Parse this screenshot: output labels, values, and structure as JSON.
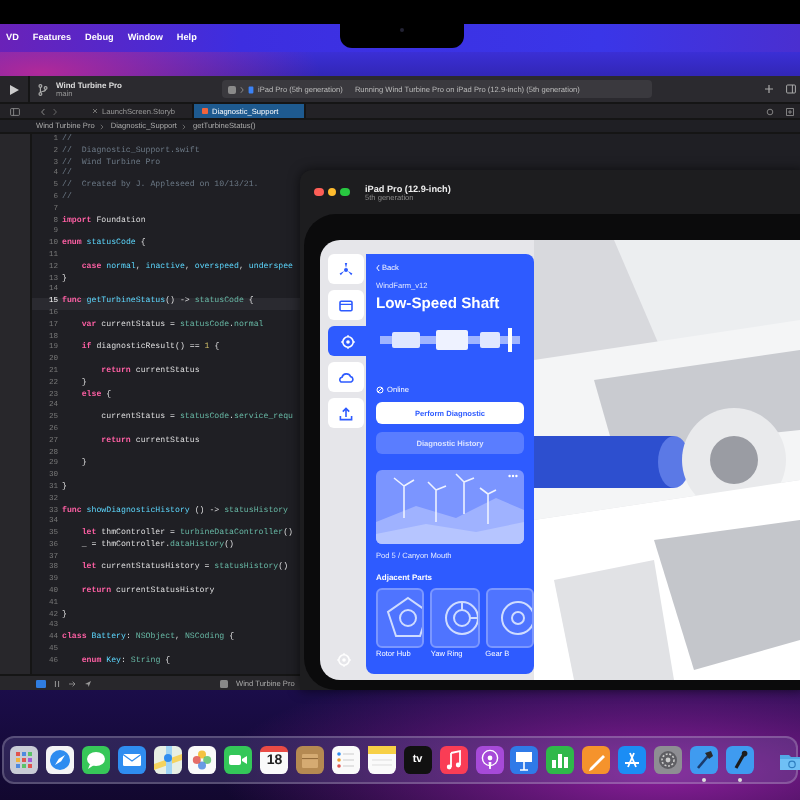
{
  "menu_bar": {
    "items": [
      "VD",
      "Features",
      "Debug",
      "Window",
      "Help"
    ]
  },
  "xcode": {
    "toolbar": {
      "project": "Wind Turbine Pro",
      "branch": "main",
      "destination": "iPad Pro (5th generation)",
      "status": "Running Wind Turbine Pro on iPad Pro (12.9-inch) (5th generation)"
    },
    "tabs": [
      {
        "label": "LaunchScreen.Storyb",
        "selected": false
      },
      {
        "label": "Diagnostic_Support",
        "selected": true
      }
    ],
    "breadcrumb": [
      "Wind Turbine Pro",
      "Diagnostic_Support",
      "getTurbineStatus()"
    ],
    "lines": [
      {
        "no": "1",
        "current": false,
        "parts": [
          {
            "kind": "comment",
            "text": "//"
          }
        ]
      },
      {
        "no": "2",
        "current": false,
        "parts": [
          {
            "kind": "comment",
            "text": "//  Diagnostic_Support.swift"
          }
        ]
      },
      {
        "no": "3",
        "current": false,
        "parts": [
          {
            "kind": "comment",
            "text": "//  Wind Turbine Pro"
          }
        ]
      },
      {
        "no": "4",
        "current": false,
        "parts": [
          {
            "kind": "comment",
            "text": "//"
          }
        ]
      },
      {
        "no": "5",
        "current": false,
        "parts": [
          {
            "kind": "comment",
            "text": "//  Created by J. Appleseed on 10/13/21."
          }
        ]
      },
      {
        "no": "6",
        "current": false,
        "parts": [
          {
            "kind": "comment",
            "text": "//"
          }
        ]
      },
      {
        "no": "7",
        "current": false
      },
      {
        "no": "8",
        "current": false,
        "parts": [
          {
            "kind": "keyword",
            "text": "import"
          },
          {
            "kind": "plain",
            "text": " Foundation"
          }
        ]
      },
      {
        "no": "9",
        "current": false
      },
      {
        "no": "10",
        "current": false,
        "parts": [
          {
            "kind": "keyword",
            "text": "enum"
          },
          {
            "kind": "name",
            "text": " statusCode"
          },
          {
            "kind": "plain",
            "text": " {"
          }
        ]
      },
      {
        "no": "11",
        "current": false
      },
      {
        "no": "12",
        "current": false,
        "parts": [
          {
            "kind": "keyword",
            "text": "    case"
          },
          {
            "kind": "name",
            "text": " normal"
          },
          {
            "kind": "plain",
            "text": ", "
          },
          {
            "kind": "name",
            "text": "inactive"
          },
          {
            "kind": "plain",
            "text": ", "
          },
          {
            "kind": "name",
            "text": "overspeed"
          },
          {
            "kind": "plain",
            "text": ", "
          },
          {
            "kind": "name",
            "text": "underspee"
          }
        ]
      },
      {
        "no": "13",
        "current": false,
        "parts": [
          {
            "kind": "plain",
            "text": "}"
          }
        ]
      },
      {
        "no": "14",
        "current": false
      },
      {
        "no": "15",
        "current": true,
        "parts": [
          {
            "kind": "keyword",
            "text": "func"
          },
          {
            "kind": "name",
            "text": " getTurbineStatus"
          },
          {
            "kind": "plain",
            "text": "() -> "
          },
          {
            "kind": "type",
            "text": "statusCode"
          },
          {
            "kind": "plain",
            "text": " {"
          }
        ]
      },
      {
        "no": "16",
        "current": false
      },
      {
        "no": "17",
        "current": false,
        "parts": [
          {
            "kind": "keyword",
            "text": "    var"
          },
          {
            "kind": "plain",
            "text": " currentStatus = "
          },
          {
            "kind": "type",
            "text": "statusCode"
          },
          {
            "kind": "plain",
            "text": "."
          },
          {
            "kind": "type",
            "text": "normal"
          }
        ]
      },
      {
        "no": "18",
        "current": false
      },
      {
        "no": "19",
        "current": false,
        "parts": [
          {
            "kind": "keyword",
            "text": "    if"
          },
          {
            "kind": "plain",
            "text": " diagnosticResult() == "
          },
          {
            "kind": "number",
            "text": "1"
          },
          {
            "kind": "plain",
            "text": " {"
          }
        ]
      },
      {
        "no": "20",
        "current": false
      },
      {
        "no": "21",
        "current": false,
        "parts": [
          {
            "kind": "keyword",
            "text": "        return"
          },
          {
            "kind": "plain",
            "text": " currentStatus"
          }
        ]
      },
      {
        "no": "22",
        "current": false,
        "parts": [
          {
            "kind": "plain",
            "text": "    }"
          }
        ]
      },
      {
        "no": "23",
        "current": false,
        "parts": [
          {
            "kind": "keyword",
            "text": "    else"
          },
          {
            "kind": "plain",
            "text": " {"
          }
        ]
      },
      {
        "no": "24",
        "current": false
      },
      {
        "no": "25",
        "current": false,
        "parts": [
          {
            "kind": "plain",
            "text": "        currentStatus = "
          },
          {
            "kind": "type",
            "text": "statusCode"
          },
          {
            "kind": "plain",
            "text": "."
          },
          {
            "kind": "type",
            "text": "service_requ"
          }
        ]
      },
      {
        "no": "26",
        "current": false
      },
      {
        "no": "27",
        "current": false,
        "parts": [
          {
            "kind": "keyword",
            "text": "        return"
          },
          {
            "kind": "plain",
            "text": " currentStatus"
          }
        ]
      },
      {
        "no": "28",
        "current": false
      },
      {
        "no": "29",
        "current": false,
        "parts": [
          {
            "kind": "plain",
            "text": "    }"
          }
        ]
      },
      {
        "no": "30",
        "current": false
      },
      {
        "no": "31",
        "current": false,
        "parts": [
          {
            "kind": "plain",
            "text": "}"
          }
        ]
      },
      {
        "no": "32",
        "current": false
      },
      {
        "no": "33",
        "current": false,
        "parts": [
          {
            "kind": "keyword",
            "text": "func"
          },
          {
            "kind": "name",
            "text": " showDiagnosticHistory"
          },
          {
            "kind": "plain",
            "text": " () -> "
          },
          {
            "kind": "type",
            "text": "statusHistory"
          }
        ]
      },
      {
        "no": "34",
        "current": false
      },
      {
        "no": "35",
        "current": false,
        "parts": [
          {
            "kind": "keyword",
            "text": "    let"
          },
          {
            "kind": "plain",
            "text": " thmController = "
          },
          {
            "kind": "type",
            "text": "turbineDataController"
          },
          {
            "kind": "plain",
            "text": "()"
          }
        ]
      },
      {
        "no": "36",
        "current": false,
        "parts": [
          {
            "kind": "plain",
            "text": "    _ = thmController."
          },
          {
            "kind": "type",
            "text": "dataHistory"
          },
          {
            "kind": "plain",
            "text": "()"
          }
        ]
      },
      {
        "no": "37",
        "current": false
      },
      {
        "no": "38",
        "current": false,
        "parts": [
          {
            "kind": "keyword",
            "text": "    let"
          },
          {
            "kind": "plain",
            "text": " currentStatusHistory = "
          },
          {
            "kind": "type",
            "text": "statusHistory"
          },
          {
            "kind": "plain",
            "text": "()"
          }
        ]
      },
      {
        "no": "39",
        "current": false
      },
      {
        "no": "40",
        "current": false,
        "parts": [
          {
            "kind": "keyword",
            "text": "    return"
          },
          {
            "kind": "plain",
            "text": " currentStatusHistory"
          }
        ]
      },
      {
        "no": "41",
        "current": false
      },
      {
        "no": "42",
        "current": false,
        "parts": [
          {
            "kind": "plain",
            "text": "}"
          }
        ]
      },
      {
        "no": "43",
        "current": false
      },
      {
        "no": "44",
        "current": false,
        "parts": [
          {
            "kind": "keyword",
            "text": "class"
          },
          {
            "kind": "name",
            "text": " Battery"
          },
          {
            "kind": "plain",
            "text": ": "
          },
          {
            "kind": "type",
            "text": "NSObject"
          },
          {
            "kind": "plain",
            "text": ", "
          },
          {
            "kind": "type",
            "text": "NSCoding"
          },
          {
            "kind": "plain",
            "text": " {"
          }
        ]
      },
      {
        "no": "45",
        "current": false
      },
      {
        "no": "46",
        "current": false,
        "parts": [
          {
            "kind": "keyword",
            "text": "    enum"
          },
          {
            "kind": "name",
            "text": " Key"
          },
          {
            "kind": "plain",
            "text": ": "
          },
          {
            "kind": "type",
            "text": "String"
          },
          {
            "kind": "plain",
            "text": " {"
          }
        ]
      }
    ],
    "debug_bar": {
      "target": "Wind Turbine Pro"
    }
  },
  "simulator": {
    "title": "iPad Pro (12.9-inch)",
    "subtitle": "5th generation",
    "sidebar": [
      {
        "kind": "fan",
        "selected": false
      },
      {
        "kind": "card",
        "selected": false
      },
      {
        "kind": "gear",
        "selected": true
      },
      {
        "kind": "cloud",
        "selected": false
      },
      {
        "kind": "upload",
        "selected": false
      }
    ],
    "panel": {
      "back": "Back",
      "subtitle": "WindFarm_v12",
      "title": "Low-Speed Shaft",
      "status": "Online",
      "primary_button": "Perform Diagnostic",
      "secondary_button": "Diagnostic History",
      "image_caption": "Pod 5 / Canyon Mouth",
      "section": "Adjacent Parts",
      "parts": [
        {
          "kind": "rotor",
          "label": "Rotor Hub"
        },
        {
          "kind": "ring",
          "label": "Yaw Ring"
        },
        {
          "kind": "gear",
          "label": "Gear B"
        }
      ]
    }
  },
  "dock": {
    "apps": [
      {
        "kind": "launchpad",
        "running": false
      },
      {
        "kind": "safari",
        "running": false
      },
      {
        "kind": "messages",
        "running": false
      },
      {
        "kind": "mail",
        "running": false
      },
      {
        "kind": "maps",
        "running": false
      },
      {
        "kind": "photos",
        "running": false
      },
      {
        "kind": "facetime",
        "running": false
      },
      {
        "kind": "calendar",
        "label": "18",
        "running": false
      },
      {
        "kind": "archive",
        "running": false
      },
      {
        "kind": "reminders",
        "running": false
      },
      {
        "kind": "notes",
        "running": false
      },
      {
        "kind": "tv",
        "label": "tv",
        "running": false
      },
      {
        "kind": "music",
        "running": false
      },
      {
        "kind": "podcasts",
        "running": false
      },
      {
        "kind": "keynote",
        "running": false
      },
      {
        "kind": "numbers",
        "running": false
      },
      {
        "kind": "pages",
        "running": false
      },
      {
        "kind": "appstore",
        "running": false
      },
      {
        "kind": "settings",
        "running": false
      },
      {
        "kind": "xcode",
        "running": true
      },
      {
        "kind": "instruments",
        "running": true
      }
    ],
    "folders": [
      {
        "kind": "downloads"
      }
    ]
  }
}
